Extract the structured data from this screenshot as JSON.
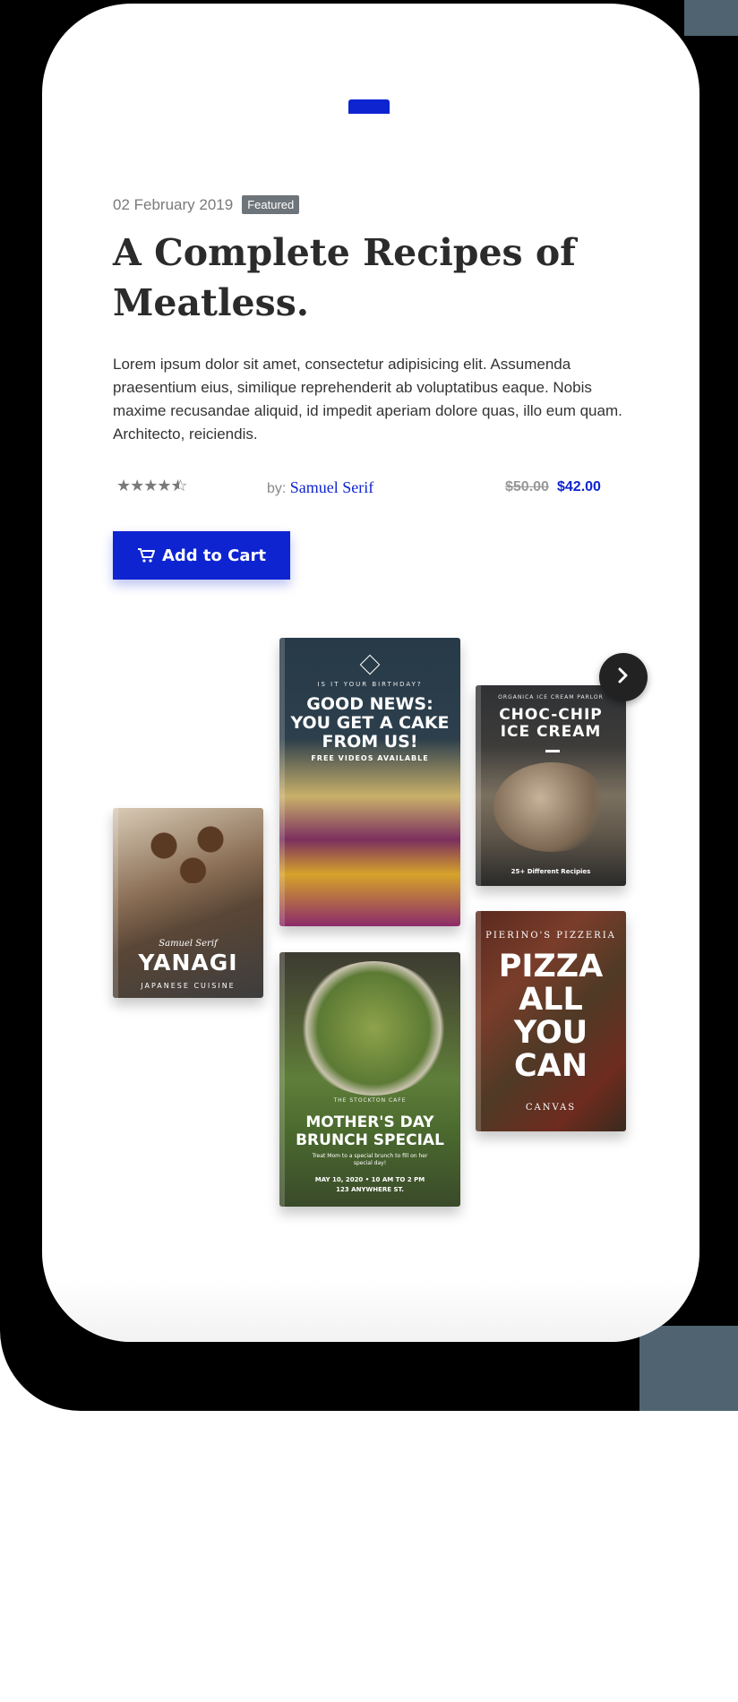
{
  "post": {
    "date": "02 February 2019",
    "badge": "Featured",
    "title": "A Complete Recipes of Meatless.",
    "description": "Lorem ipsum dolor sit amet, consectetur adipisicing elit. Assumenda praesentium eius, similique reprehenderit ab voluptatibus eaque. Nobis maxime recusandae aliquid, id impedit aperiam dolore quas, illo eum quam. Architecto, reiciendis.",
    "rating": 4.5,
    "author_prefix": "by:",
    "author": "Samuel Serif",
    "price_old": "$50.00",
    "price_new": "$42.00"
  },
  "cta": {
    "label": "Add to Cart",
    "icon": "cart-icon"
  },
  "books": {
    "yanagi": {
      "author": "Samuel Serif",
      "title": "YANAGI",
      "subtitle": "JAPANESE CUISINE"
    },
    "cake": {
      "kicker": "IS IT YOUR BIRTHDAY?",
      "title": "GOOD NEWS: YOU GET A CAKE FROM US!",
      "subtitle": "FREE VIDEOS AVAILABLE"
    },
    "choc": {
      "kicker": "ORGANICA ICE CREAM PARLOR",
      "title": "CHOC-CHIP ICE CREAM",
      "footer": "25+ Different Recipies"
    },
    "salad": {
      "kicker": "THE STOCKTON CAFE",
      "title": "MOTHER'S DAY BRUNCH SPECIAL",
      "detail": "Treat Mom to a special brunch to fill on her special day!",
      "date": "MAY 10, 2020 • 10 AM TO 2 PM",
      "address": "123 ANYWHERE ST."
    },
    "pizza": {
      "kicker": "PIERINO'S PIZZERIA",
      "title": "PIZZA ALL YOU CAN",
      "footer": "CANVAS"
    }
  },
  "carousel": {
    "next_icon": "chevron-right-icon"
  },
  "colors": {
    "accent": "#0e24d1",
    "text": "#2b2b2b",
    "muted": "#7a7a7a",
    "badge": "#6d747a"
  }
}
